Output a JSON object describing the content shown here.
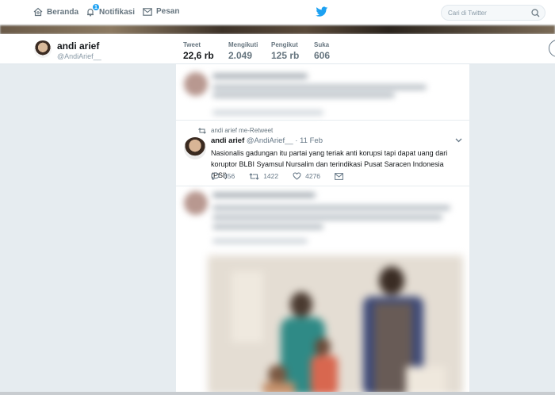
{
  "nav": {
    "home": "Beranda",
    "notifications": "Notifikasi",
    "notification_count": "1",
    "messages": "Pesan",
    "search_placeholder": "Cari di Twitter"
  },
  "profile": {
    "name": "andi arief",
    "handle": "@AndiArief__",
    "stats": [
      {
        "label": "Tweet",
        "value": "22,6 rb"
      },
      {
        "label": "Mengikuti",
        "value": "2.049"
      },
      {
        "label": "Pengikut",
        "value": "125 rb"
      },
      {
        "label": "Suka",
        "value": "606"
      }
    ]
  },
  "tweet": {
    "retweet_note": "andi arief me-Retweet",
    "author_name": "andi arief",
    "author_handle": "@AndiArief__",
    "date": "· 11 Feb",
    "text": "Nasionalis gadungan itu partai yang teriak anti korupsi tapi dapat uang dari koruptor BLBI Syamsul Nursalim  dan terindikasi Pusat Saracen Indonesia (PSI)",
    "replies": "356",
    "retweets": "1422",
    "likes": "4276"
  },
  "colors": {
    "accent": "#1da1f2",
    "background": "#e6ecf0",
    "like_icon": "#657786"
  },
  "icons": {
    "home": "home-icon",
    "notifications": "bell-icon",
    "messages": "envelope-icon",
    "logo": "twitter-bird-icon",
    "search": "search-icon",
    "retweet": "retweet-icon",
    "reply": "reply-icon",
    "like": "heart-icon",
    "dm": "envelope-icon",
    "more": "chevron-down-icon"
  }
}
